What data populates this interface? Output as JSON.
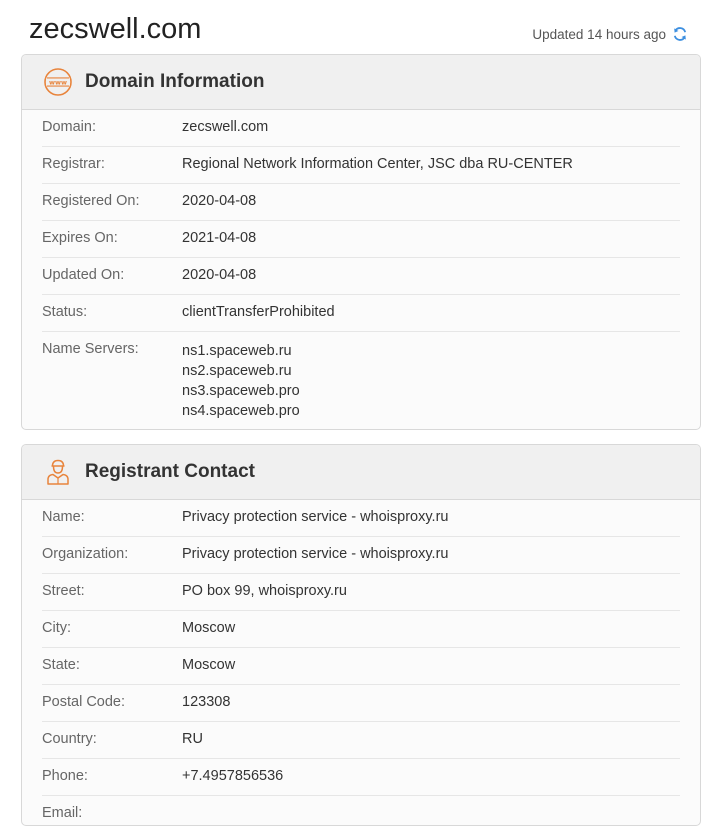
{
  "header": {
    "domain_title": "zecswell.com",
    "updated_text": "Updated 14 hours ago"
  },
  "domain_info": {
    "title": "Domain Information",
    "icon": "www-globe-icon",
    "rows": [
      {
        "label": "Domain:",
        "value": "zecswell.com"
      },
      {
        "label": "Registrar:",
        "value": "Regional Network Information Center, JSC dba RU-CENTER"
      },
      {
        "label": "Registered On:",
        "value": "2020-04-08"
      },
      {
        "label": "Expires On:",
        "value": "2021-04-08"
      },
      {
        "label": "Updated On:",
        "value": "2020-04-08"
      },
      {
        "label": "Status:",
        "value": "clientTransferProhibited"
      }
    ],
    "name_servers": {
      "label": "Name Servers:",
      "values": [
        "ns1.spaceweb.ru",
        "ns2.spaceweb.ru",
        "ns3.spaceweb.pro",
        "ns4.spaceweb.pro"
      ]
    }
  },
  "registrant": {
    "title": "Registrant Contact",
    "icon": "person-icon",
    "rows": [
      {
        "label": "Name:",
        "value": "Privacy protection service - whoisproxy.ru"
      },
      {
        "label": "Organization:",
        "value": "Privacy protection service - whoisproxy.ru"
      },
      {
        "label": "Street:",
        "value": "PO box 99, whoisproxy.ru"
      },
      {
        "label": "City:",
        "value": "Moscow"
      },
      {
        "label": "State:",
        "value": "Moscow"
      },
      {
        "label": "Postal Code:",
        "value": "123308"
      },
      {
        "label": "Country:",
        "value": "RU"
      },
      {
        "label": "Phone:",
        "value": "+7.4957856536"
      },
      {
        "label": "Email:",
        "value": ""
      }
    ]
  },
  "colors": {
    "accent_orange": "#e8843c",
    "refresh_blue": "#3d8fe0"
  }
}
